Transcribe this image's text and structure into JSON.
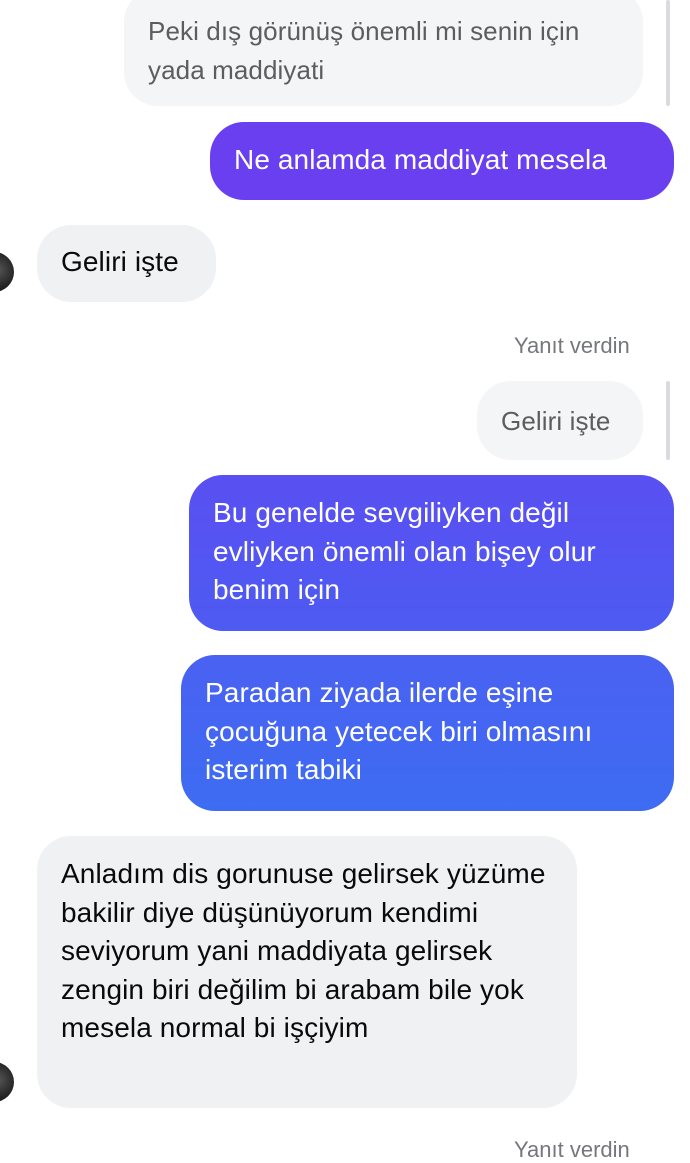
{
  "messages": [
    {
      "text": "Peki dış görünüş önemli mi senin için yada maddiyati"
    },
    {
      "text": "Ne anlamda maddiyat mesela"
    },
    {
      "text": "Geliri işte"
    },
    {
      "text": "Geliri işte"
    },
    {
      "text": "Bu genelde sevgiliyken değil evliyken önemli olan bişey olur benim için"
    },
    {
      "text": "Paradan ziyada ilerde eşine çocuğuna yetecek biri olmasını isterim tabiki"
    },
    {
      "text": "Anladım dis gorunuse gelirsek yüzüme bakilir diye düşünüyorum kendimi seviyorum yani maddiyata gelirsek zengin biri değilim bi arabam bile yok mesela normal bi işçiyim"
    }
  ],
  "meta": {
    "replied_label": "Yanıt verdin",
    "replied_label_bottom": "Yanıt verdin"
  },
  "colors": {
    "outgoing_gradient_top": "#6a3ff0",
    "outgoing_gradient_bottom": "#3d6cf2",
    "incoming_bubble": "#eff1f3",
    "reply_quote_bubble": "#f4f5f6"
  }
}
